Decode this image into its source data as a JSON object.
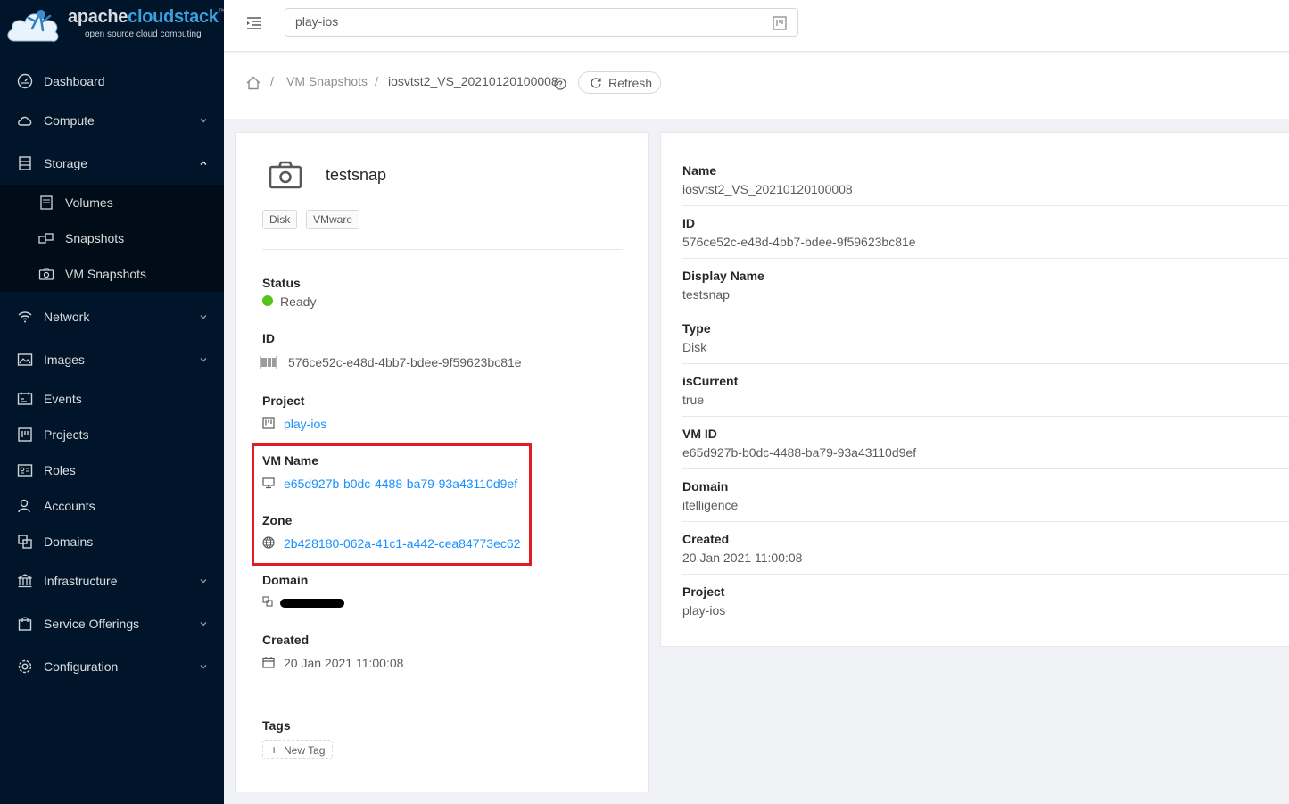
{
  "logo": {
    "brand_a": "apache",
    "brand_b": "cloudstack",
    "tm": "™",
    "tagline": "open source cloud computing"
  },
  "sidebar": {
    "items": [
      {
        "label": "Dashboard",
        "icon": "dashboard-icon"
      },
      {
        "label": "Compute",
        "icon": "cloud-icon"
      },
      {
        "label": "Storage",
        "icon": "database-icon"
      },
      {
        "label": "Volumes",
        "icon": "hdd-icon"
      },
      {
        "label": "Snapshots",
        "icon": "build-icon"
      },
      {
        "label": "VM Snapshots",
        "icon": "camera-icon"
      },
      {
        "label": "Network",
        "icon": "wifi-icon"
      },
      {
        "label": "Images",
        "icon": "picture-icon"
      },
      {
        "label": "Events",
        "icon": "schedule-icon"
      },
      {
        "label": "Projects",
        "icon": "project-icon"
      },
      {
        "label": "Roles",
        "icon": "idcard-icon"
      },
      {
        "label": "Accounts",
        "icon": "team-icon"
      },
      {
        "label": "Domains",
        "icon": "block-icon"
      },
      {
        "label": "Infrastructure",
        "icon": "bank-icon"
      },
      {
        "label": "Service Offerings",
        "icon": "shopping-icon"
      },
      {
        "label": "Configuration",
        "icon": "setting-icon"
      }
    ]
  },
  "header": {
    "project_value": "play-ios"
  },
  "breadcrumb": {
    "sep": "/",
    "parent": "VM Snapshots",
    "current": "iosvtst2_VS_20210120100008",
    "refresh_label": "Refresh"
  },
  "detail": {
    "name": "testsnap",
    "tags": [
      "Disk",
      "VMware"
    ],
    "status_label": "Status",
    "status_value": "Ready",
    "id_label": "ID",
    "id_value": "576ce52c-e48d-4bb7-bdee-9f59623bc81e",
    "project_label": "Project",
    "project_value": "play-ios",
    "vmname_label": "VM Name",
    "vmname_value": "e65d927b-b0dc-4488-ba79-93a43110d9ef",
    "zone_label": "Zone",
    "zone_value": "2b428180-062a-41c1-a442-cea84773ec62",
    "domain_label": "Domain",
    "created_label": "Created",
    "created_value": "20 Jan 2021 11:00:08",
    "tags_label": "Tags",
    "new_tag_label": "New Tag"
  },
  "info": [
    {
      "label": "Name",
      "value": "iosvtst2_VS_20210120100008"
    },
    {
      "label": "ID",
      "value": "576ce52c-e48d-4bb7-bdee-9f59623bc81e"
    },
    {
      "label": "Display Name",
      "value": "testsnap"
    },
    {
      "label": "Type",
      "value": "Disk"
    },
    {
      "label": "isCurrent",
      "value": "true"
    },
    {
      "label": "VM ID",
      "value": "e65d927b-b0dc-4488-ba79-93a43110d9ef"
    },
    {
      "label": "Domain",
      "value": "itelligence"
    },
    {
      "label": "Created",
      "value": "20 Jan 2021 11:00:08"
    },
    {
      "label": "Project",
      "value": "play-ios"
    }
  ],
  "colors": {
    "sidebar_bg": "#001529",
    "link": "#1890ff",
    "status_ready": "#52c41a",
    "highlight": "#e01b24"
  }
}
